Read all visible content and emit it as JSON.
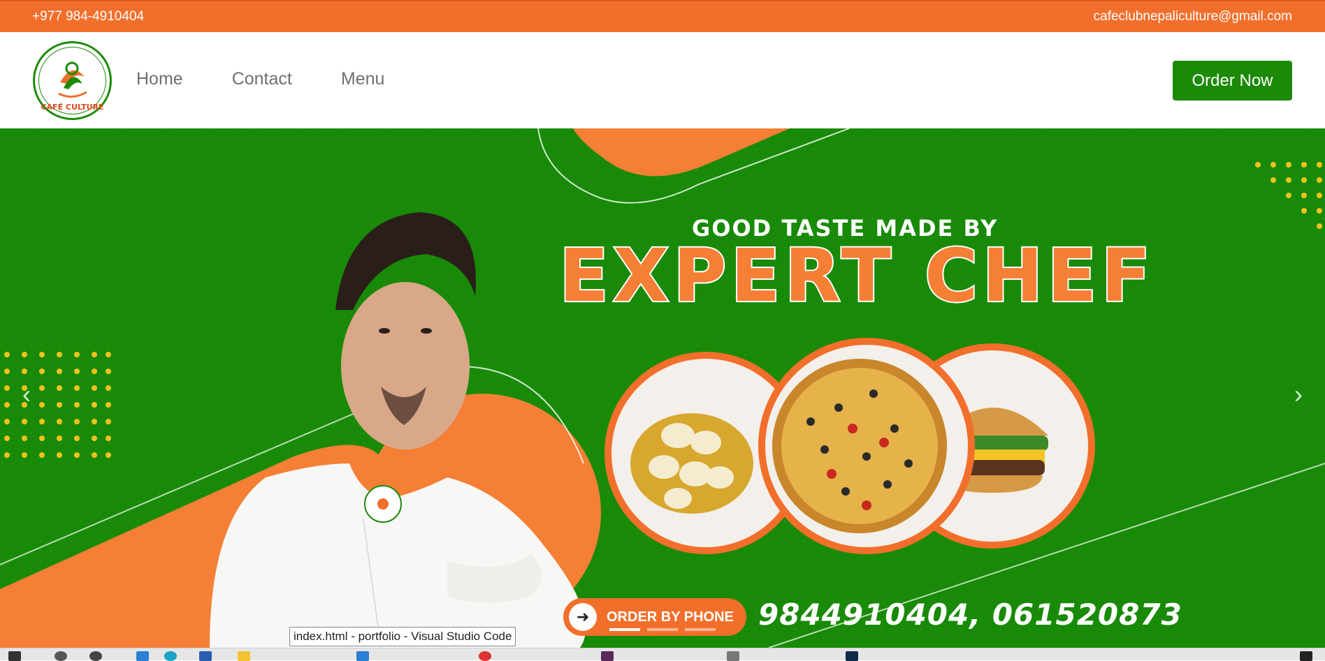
{
  "topbar": {
    "phone": "+977 984-4910404",
    "email": "cafeclubnepaliculture@gmail.com"
  },
  "brand": {
    "logo_text": "CAFÉ CULTURE",
    "colors": {
      "orange": "#f26f2b",
      "green": "#1c8a07",
      "white": "#ffffff"
    }
  },
  "nav": {
    "items": [
      {
        "label": "Home"
      },
      {
        "label": "Contact"
      },
      {
        "label": "Menu"
      }
    ],
    "order_button": "Order Now"
  },
  "hero": {
    "headline_small": "GOOD TASTE MADE BY",
    "headline_big": "EXPERT CHEF",
    "order_by_phone": "ORDER BY PHONE",
    "phone_numbers": "9844910404, 061520873",
    "prev_icon": "chevron-left-icon",
    "next_icon": "chevron-right-icon",
    "prev_glyph": "‹",
    "next_glyph": "›",
    "slides": 3,
    "active_slide": 1
  },
  "tooltip": {
    "text": "index.html - portfolio - Visual Studio Code"
  }
}
